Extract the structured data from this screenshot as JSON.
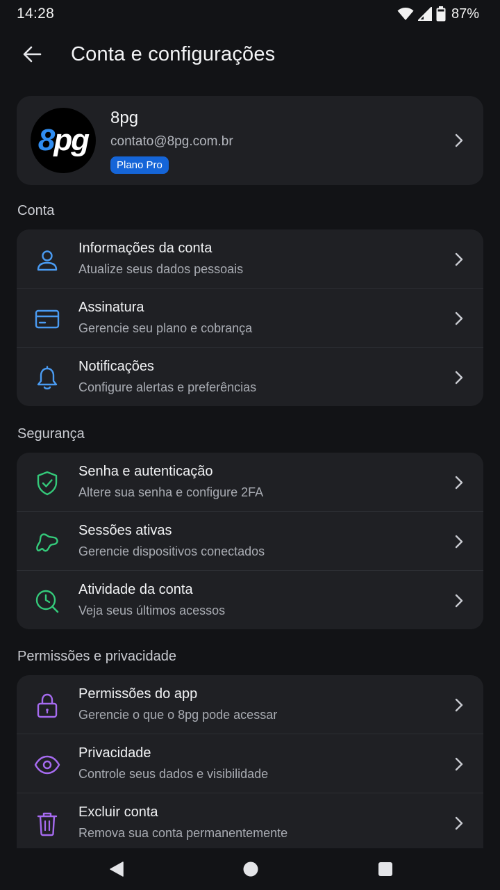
{
  "status_bar": {
    "time": "14:28",
    "battery": "87%",
    "icons": [
      "wifi-icon",
      "signal-icon",
      "battery-icon"
    ]
  },
  "header": {
    "back_icon": "arrow-left-icon",
    "title": "Conta e configurações"
  },
  "profile": {
    "name": "8pg",
    "email": "contato@8pg.com.br",
    "plan": "Plano Pro",
    "logo_accent": "8",
    "logo_rest": "pg"
  },
  "sections": [
    {
      "title": "Conta",
      "items": [
        {
          "title": "Informações da conta",
          "subtitle": "Atualize seus dados pessoais",
          "icon": "person-icon",
          "color": "#4A9BF2"
        },
        {
          "title": "Assinatura",
          "subtitle": "Gerencie seu plano e cobrança",
          "icon": "credit-card-icon",
          "color": "#4A9BF2"
        },
        {
          "title": "Notificações",
          "subtitle": "Configure alertas e preferências",
          "icon": "bell-icon",
          "color": "#4A9BF2"
        }
      ]
    },
    {
      "title": "Segurança",
      "items": [
        {
          "title": "Senha e autenticação",
          "subtitle": "Altere sua senha e configure 2FA",
          "icon": "shield-check-icon",
          "color": "#34C97A"
        },
        {
          "title": "Sessões ativas",
          "subtitle": "Gerencie dispositivos conectados",
          "icon": "devices-icon",
          "color": "#34C97A"
        },
        {
          "title": "Atividade da conta",
          "subtitle": "Veja seus últimos acessos",
          "icon": "clock-search-icon",
          "color": "#34C97A"
        }
      ]
    },
    {
      "title": "Permissões e privacidade",
      "items": [
        {
          "title": "Permissões do app",
          "subtitle": "Gerencie o que o 8pg pode acessar",
          "icon": "lock-icon",
          "color": "#A66BF0"
        },
        {
          "title": "Privacidade",
          "subtitle": "Controle seus dados e visibilidade",
          "icon": "eye-icon",
          "color": "#A66BF0"
        },
        {
          "title": "Excluir conta",
          "subtitle": "Remova sua conta permanentemente",
          "icon": "trash-icon",
          "color": "#A66BF0"
        }
      ]
    }
  ],
  "nav": {
    "icons": [
      "back-triangle-icon",
      "home-circle-icon",
      "recents-square-icon"
    ]
  }
}
